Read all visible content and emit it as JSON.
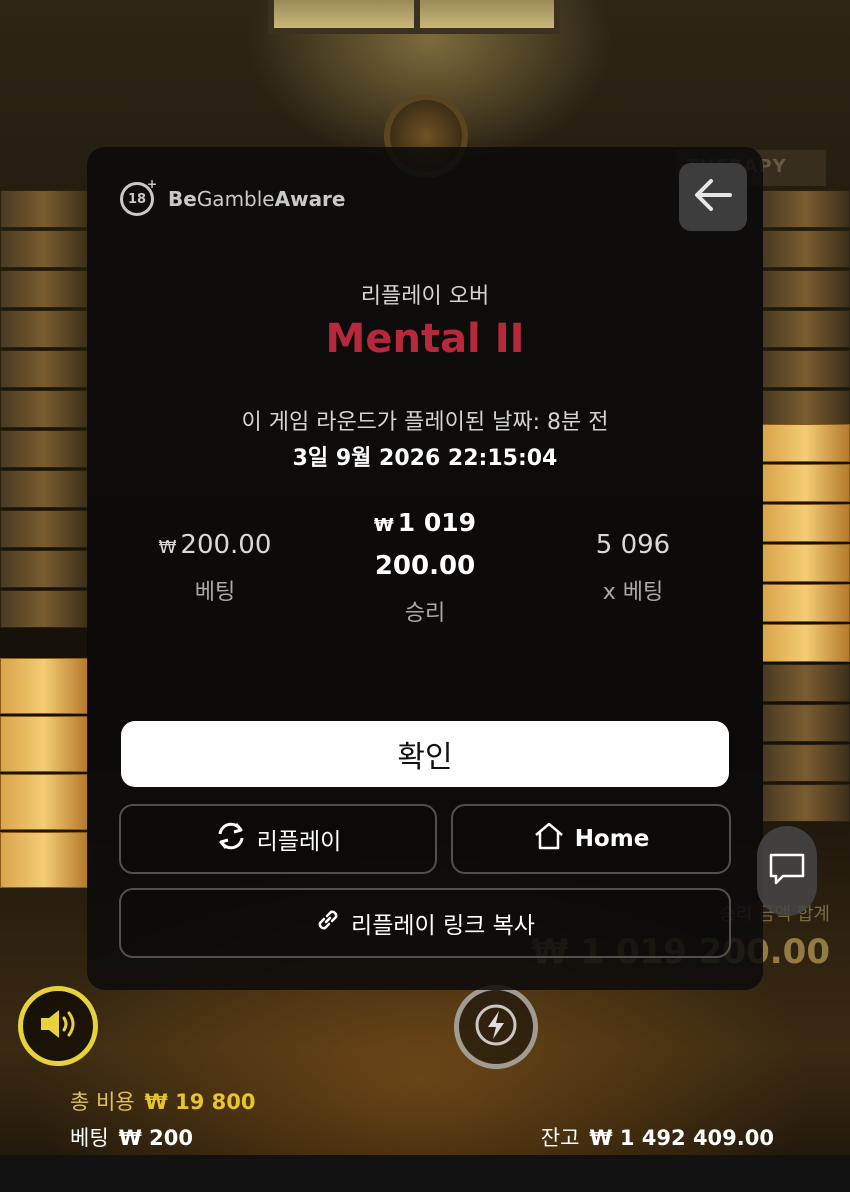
{
  "modal": {
    "gamble_aware_prefix": "Be",
    "gamble_aware_mid": "Gamble",
    "gamble_aware_suffix": "Aware",
    "age_badge": "18",
    "replay_over_label": "리플레이 오버",
    "game_title": "Mental II",
    "played_when": "이 게임 라운드가 플레이된 날짜: 8분 전",
    "played_date": "3일 9월 2026 22:15:04",
    "bet": {
      "currency": "₩",
      "value": "200.00",
      "label": "베팅"
    },
    "win": {
      "currency": "₩",
      "value_line1": "1 019",
      "value_line2": "200.00",
      "label": "승리"
    },
    "multiplier": {
      "value": "5 096",
      "label": "x 베팅"
    },
    "confirm_label": "확인",
    "replay_label": "리플레이",
    "home_label": "Home",
    "copy_link_label": "리플레이 링크 복사"
  },
  "background": {
    "sign_text": "THERAPY",
    "win_total_label": "승리 금액 합계",
    "win_total_value": "₩ 1 019 200.00"
  },
  "hud": {
    "total_cost_label": "총 비용",
    "total_cost_value": "₩ 19 800",
    "bet_label": "베팅",
    "bet_value": "₩ 200",
    "balance_label": "잔고",
    "balance_value": "₩ 1 492 409.00"
  },
  "colors": {
    "title_red": "#b8283c",
    "hud_yellow": "#e6c52c",
    "sound_ring": "#e7d23b"
  },
  "icons": {
    "back": "arrow-left-icon",
    "replay": "refresh-icon",
    "home": "home-icon",
    "copy": "link-icon",
    "chat": "chat-icon",
    "sound": "speaker-icon",
    "turbo": "lightning-icon"
  }
}
